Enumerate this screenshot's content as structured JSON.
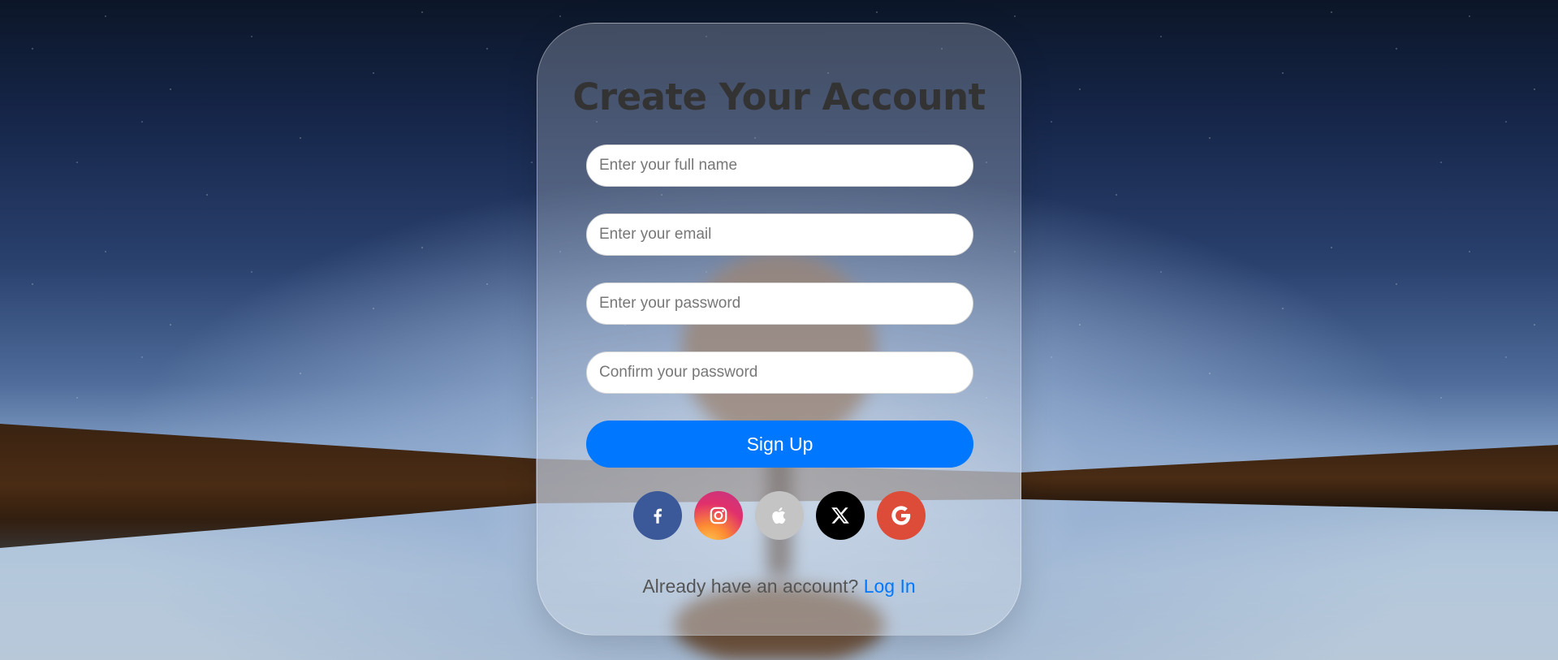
{
  "page": {
    "title": "Create Your Account"
  },
  "form": {
    "full_name": {
      "placeholder": "Enter your full name",
      "value": ""
    },
    "email": {
      "placeholder": "Enter your email",
      "value": ""
    },
    "password": {
      "placeholder": "Enter your password",
      "value": ""
    },
    "confirm_password": {
      "placeholder": "Confirm your password",
      "value": ""
    },
    "submit_label": "Sign Up"
  },
  "social": [
    {
      "icon": "facebook-icon",
      "color": "#3b5998"
    },
    {
      "icon": "instagram-icon",
      "color": "#e1306c"
    },
    {
      "icon": "apple-icon",
      "color": "#c4c4c4"
    },
    {
      "icon": "x-icon",
      "color": "#000000"
    },
    {
      "icon": "google-icon",
      "color": "#dd4b39"
    }
  ],
  "footer": {
    "prompt": "Already have an account?",
    "link_label": "Log In"
  },
  "colors": {
    "accent": "#0077ff",
    "title": "#333333"
  }
}
